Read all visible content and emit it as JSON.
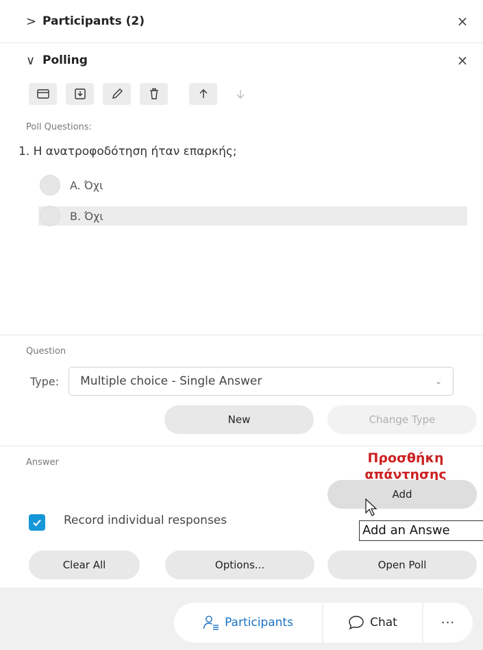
{
  "participants_panel": {
    "chevron": ">",
    "title": "Participants (2)",
    "close": "×"
  },
  "polling_panel": {
    "chevron": "∨",
    "title": "Polling",
    "close": "×"
  },
  "toolbar": {
    "icons": [
      "folder-open-icon",
      "save-download-icon",
      "edit-pencil-icon",
      "delete-trash-icon",
      "move-up-arrow-icon",
      "move-down-arrow-icon"
    ]
  },
  "poll": {
    "section_label": "Poll Questions:",
    "question": "1. Η ανατροφοδότηση ήταν επαρκής;",
    "options": [
      "A.  Όχι",
      "B.  Όχι"
    ]
  },
  "question_section": {
    "label": "Question",
    "type_label": "Type:",
    "type_value": "Multiple choice - Single Answer",
    "new_button": "New",
    "change_type_button": "Change Type"
  },
  "answer_section": {
    "label": "Answer",
    "annotation_line1": "Προσθήκη",
    "annotation_line2": "απάντησης",
    "add_button": "Add",
    "tooltip": "Add an Answe",
    "record_label": "Record individual responses",
    "record_checked": true
  },
  "actions": {
    "clear_all": "Clear All",
    "options": "Options...",
    "open_poll": "Open Poll"
  },
  "bottom_bar": {
    "participants": "Participants",
    "chat": "Chat",
    "more": "···"
  },
  "colors": {
    "accent": "#1597d8",
    "annotation_red": "#cc2222",
    "button_bg": "#e8e8e8",
    "bar_bg": "#f0f0f0"
  }
}
